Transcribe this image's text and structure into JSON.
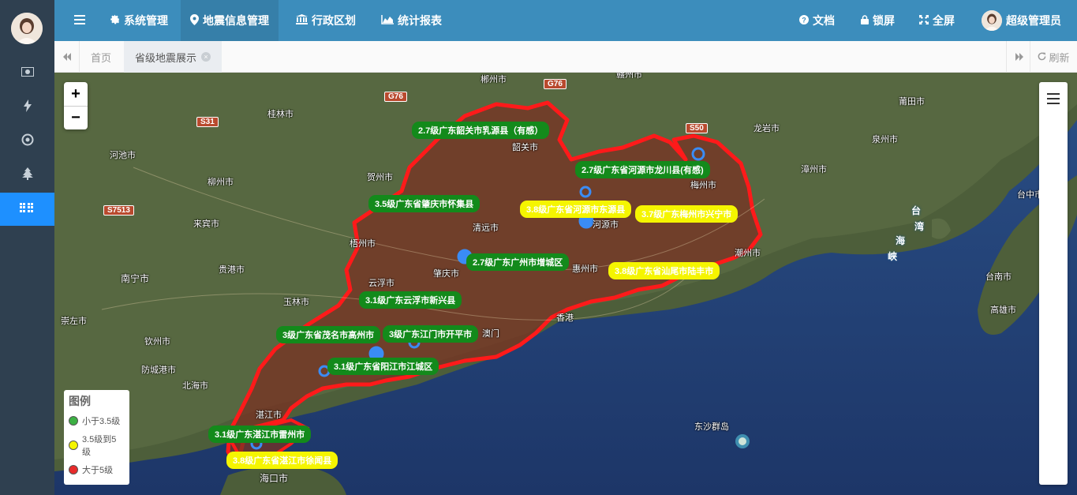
{
  "header": {
    "nav": [
      {
        "icon": "gear-icon",
        "label": "系统管理"
      },
      {
        "icon": "map-pin-icon",
        "label": "地震信息管理"
      },
      {
        "icon": "bank-icon",
        "label": "行政区划"
      },
      {
        "icon": "area-chart-icon",
        "label": "统计报表"
      }
    ],
    "right": {
      "docs": "文档",
      "lock": "锁屏",
      "fullscreen": "全屏",
      "user": "超级管理员"
    }
  },
  "sidebar": {
    "items": [
      {
        "icon": "money-icon"
      },
      {
        "icon": "bolt-icon"
      },
      {
        "icon": "target-icon"
      },
      {
        "icon": "tree-icon"
      },
      {
        "icon": "grid-icon",
        "active": true
      }
    ]
  },
  "tabs": {
    "items": [
      {
        "label": "首页"
      },
      {
        "label": "省级地震展示",
        "active": true
      }
    ],
    "refresh": "刷新"
  },
  "map": {
    "zoom_in": "+",
    "zoom_out": "−",
    "legend": {
      "title": "图例",
      "items": [
        {
          "label": "小于3.5级",
          "color": "#3cb043"
        },
        {
          "label": "3.5级到5级",
          "color": "#f5f500"
        },
        {
          "label": "大于5级",
          "color": "#e82a2a"
        }
      ]
    },
    "earthquakes": [
      {
        "label": "2.7级广东韶关市乳源县（有感）",
        "level": "green"
      },
      {
        "label": "2.7级广东省河源市龙川县(有感)",
        "level": "green"
      },
      {
        "label": "3.5级广东省肇庆市怀集县",
        "level": "green"
      },
      {
        "label": "3.8级广东省河源市东源县",
        "level": "yellow"
      },
      {
        "label": "3.7级广东梅州市兴宁市",
        "level": "yellow"
      },
      {
        "label": "2.7级广东广州市增城区",
        "level": "green"
      },
      {
        "label": "3.8级广东省汕尾市陆丰市",
        "level": "yellow"
      },
      {
        "label": "3.1级广东云浮市新兴县",
        "level": "green"
      },
      {
        "label": "3级广东省茂名市高州市",
        "level": "green"
      },
      {
        "label": "3级广东江门市开平市",
        "level": "green"
      },
      {
        "label": "3.1级广东省阳江市江城区",
        "level": "green"
      },
      {
        "label": "3.1级广东湛江市雷州市",
        "level": "green"
      },
      {
        "label": "3.8级广东省湛江市徐闻县",
        "level": "yellow"
      }
    ],
    "places": [
      "郴州市",
      "赣州市",
      "桂林市",
      "韶关市",
      "龙岩市",
      "莆田市",
      "河池市",
      "贺州市",
      "梅州市",
      "泉州市",
      "柳州市",
      "漳州市",
      "河源市",
      "来宾市",
      "清远市",
      "潮州市",
      "贵港市",
      "梧州市",
      "云浮市",
      "肇庆市",
      "惠州市",
      "南宁市",
      "玉林市",
      "香港",
      "澳门",
      "钦州市",
      "崇左市",
      "防城港市",
      "北海市",
      "湛江市",
      "海口市",
      "东沙群岛",
      "台南市",
      "高雄市",
      "台中市"
    ],
    "roads": [
      "G76",
      "G76",
      "S31",
      "S50",
      "S7513"
    ],
    "strait_chars": [
      "台",
      "湾",
      "海",
      "峡"
    ]
  }
}
